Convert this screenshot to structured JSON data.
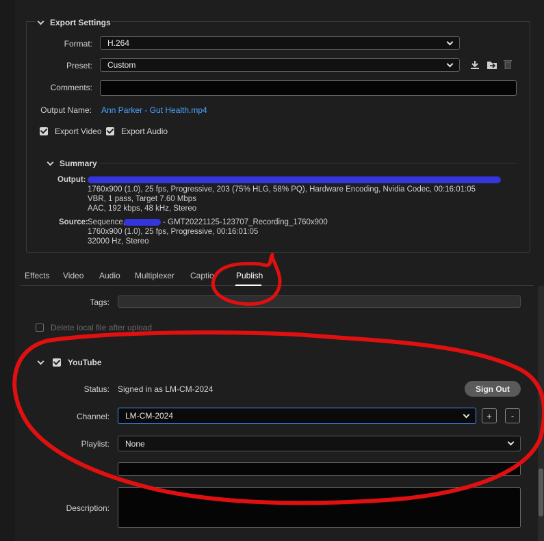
{
  "export_settings": {
    "title": "Export Settings",
    "format_label": "Format:",
    "format_value": "H.264",
    "preset_label": "Preset:",
    "preset_value": "Custom",
    "comments_label": "Comments:",
    "comments_value": "",
    "output_name_label": "Output Name:",
    "output_name_value": "Ann Parker - Gut Health.mp4",
    "export_video_label": "Export Video",
    "export_video_checked": true,
    "export_audio_label": "Export Audio",
    "export_audio_checked": true
  },
  "summary": {
    "title": "Summary",
    "output_label": "Output:",
    "output_lines": [
      "1760x900 (1.0), 25 fps, Progressive, 203 (75% HLG, 58% PQ), Hardware Encoding, Nvidia Codec, 00:16:01:05",
      "VBR, 1 pass, Target 7.60 Mbps",
      "AAC, 192 kbps, 48 kHz, Stereo"
    ],
    "source_label": "Source:",
    "source_prefix": "Sequence,",
    "source_suffix": "- GMT20221125-123707_Recording_1760x900",
    "source_lines": [
      "1760x900 (1.0), 25 fps, Progressive, 00:16:01:05",
      "32000 Hz, Stereo"
    ]
  },
  "tabs": [
    "Effects",
    "Video",
    "Audio",
    "Multiplexer",
    "Captio",
    "Publish"
  ],
  "active_tab": "Publish",
  "publish": {
    "tags_label": "Tags:",
    "tags_value": "",
    "delete_local_label": "Delete local file after upload",
    "youtube_title": "YouTube",
    "youtube_checked": true,
    "status_label": "Status:",
    "status_value": "Signed in as LM-CM-2024",
    "sign_out_label": "Sign Out",
    "channel_label": "Channel:",
    "channel_value": "LM-CM-2024",
    "add_label": "+",
    "remove_label": "-",
    "playlist_label": "Playlist:",
    "playlist_value": "None",
    "title_value": "",
    "description_label": "Description:",
    "description_value": ""
  },
  "colors": {
    "background": "#1e1e1e",
    "link": "#4aa3ff",
    "redaction": "#3a3aff",
    "annotation": "#e01010",
    "focus": "#4a90ff"
  }
}
